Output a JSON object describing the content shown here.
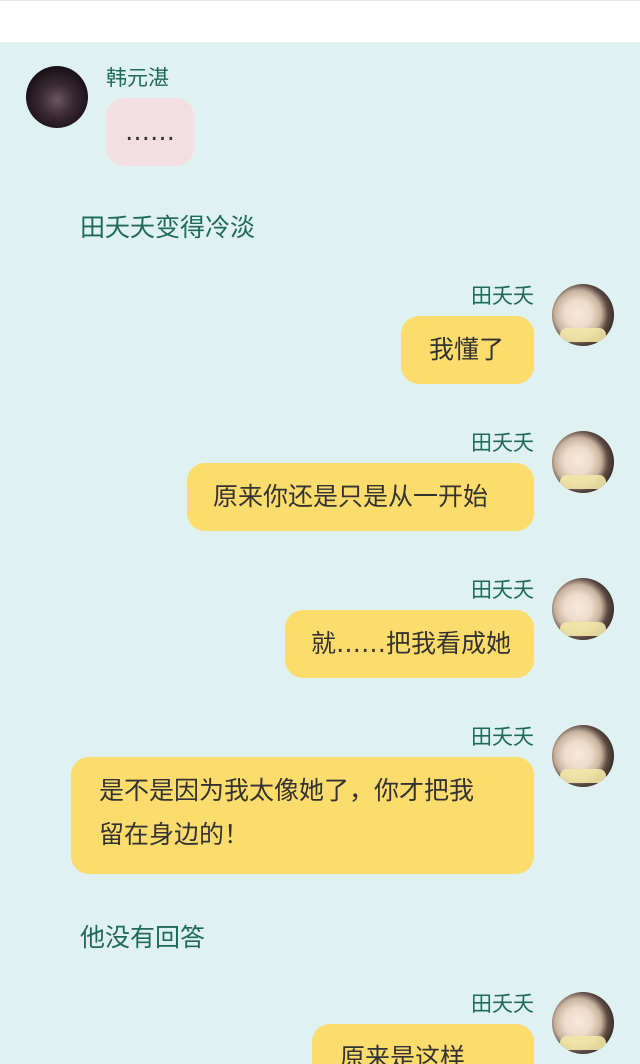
{
  "messages": [
    {
      "type": "left",
      "name": "韩元湛",
      "text": "……",
      "avatar": "dark-haired-man-avatar"
    },
    {
      "type": "narration",
      "text": "田夭夭变得冷淡"
    },
    {
      "type": "right",
      "name": "田夭夭",
      "text": "我懂了",
      "avatar": "girl-avatar"
    },
    {
      "type": "right",
      "name": "田夭夭",
      "text": "原来你还是只是从一开始",
      "avatar": "girl-avatar"
    },
    {
      "type": "right",
      "name": "田夭夭",
      "text": "就……把我看成她",
      "avatar": "girl-avatar"
    },
    {
      "type": "right",
      "name": "田夭夭",
      "text_line1": "是不是因为我太像她了，你才把我",
      "text_line2": "留在身边的！",
      "avatar": "girl-avatar"
    },
    {
      "type": "narration",
      "text": "他没有回答"
    },
    {
      "type": "right",
      "name": "田夭夭",
      "text": "原来是这样",
      "avatar": "girl-avatar"
    }
  ],
  "colors": {
    "background": "#dff1f0",
    "name_text": "#1f6a5a",
    "right_bubble": "#fcdc6c",
    "left_bubble": "#f3dfe1"
  }
}
